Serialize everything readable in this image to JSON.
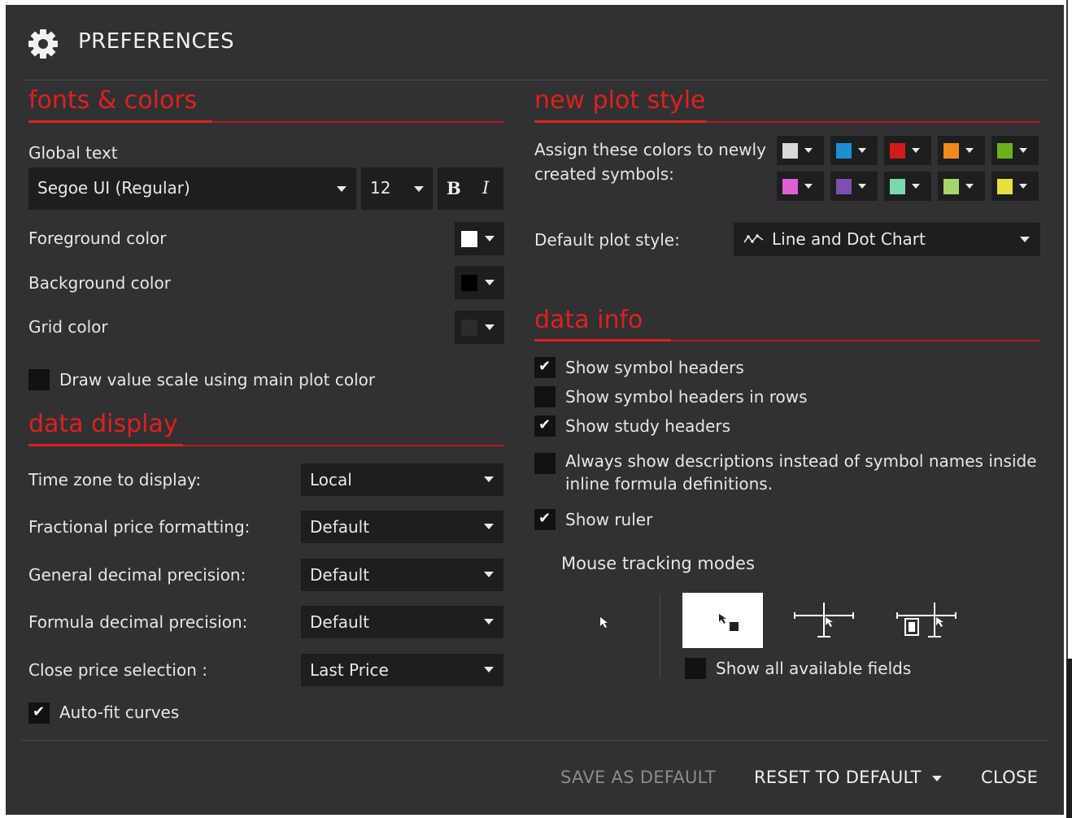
{
  "dialog": {
    "title": "PREFERENCES",
    "icon": "gear-icon"
  },
  "fonts_colors": {
    "title": "fonts & colors",
    "global_text_label": "Global text",
    "font_family": "Segoe UI (Regular)",
    "font_size": "12",
    "bold_label": "B",
    "italic_label": "I",
    "foreground_label": "Foreground color",
    "foreground_color": "#ffffff",
    "background_label": "Background color",
    "background_color": "#000000",
    "grid_label": "Grid color",
    "grid_color": "#2b2c2e",
    "draw_value_scale_label": "Draw value scale using main plot color",
    "draw_value_scale_checked": false
  },
  "data_display": {
    "title": "data display",
    "rows": [
      {
        "label": "Time zone to display:",
        "value": "Local"
      },
      {
        "label": "Fractional price formatting:",
        "value": "Default"
      },
      {
        "label": "General decimal precision:",
        "value": "Default"
      },
      {
        "label": "Formula decimal precision:",
        "value": "Default"
      },
      {
        "label": "Close price selection :",
        "value": "Last Price"
      }
    ],
    "auto_fit_label": "Auto-fit curves",
    "auto_fit_checked": true
  },
  "new_plot_style": {
    "title": "new plot style",
    "assign_label_1": "Assign these colors to newly",
    "assign_label_2": "created symbols:",
    "colors": [
      "#d8d8d8",
      "#1b8fd1",
      "#d51a1a",
      "#ef8a1f",
      "#6cb11b",
      "#df5fd8",
      "#7d4fae",
      "#79d9ac",
      "#a5d56b",
      "#e5e040"
    ],
    "default_plot_label": "Default plot style:",
    "default_plot_value": "Line and Dot Chart",
    "default_plot_icon": "line-dot-chart-icon"
  },
  "data_info": {
    "title": "data info",
    "options": [
      {
        "label": "Show symbol headers",
        "checked": true
      },
      {
        "label": "Show symbol headers in rows",
        "checked": false
      },
      {
        "label": "Show study headers",
        "checked": true
      },
      {
        "label": "Always show descriptions instead of symbol names inside",
        "label2": "inline formula definitions.",
        "checked": false
      },
      {
        "label": "Show ruler",
        "checked": true
      }
    ],
    "mouse_tracking_label": "Mouse tracking modes",
    "mouse_modes": [
      "pointer-mode-icon",
      "pointer-box-mode-icon",
      "crosshair-mode-icon",
      "crosshair-box-mode-icon"
    ],
    "selected_mode": 1,
    "show_all_fields_label": "Show all available fields",
    "show_all_fields_checked": false
  },
  "footer": {
    "save_default": "SAVE AS DEFAULT",
    "reset_default": "RESET TO DEFAULT",
    "close": "CLOSE"
  }
}
